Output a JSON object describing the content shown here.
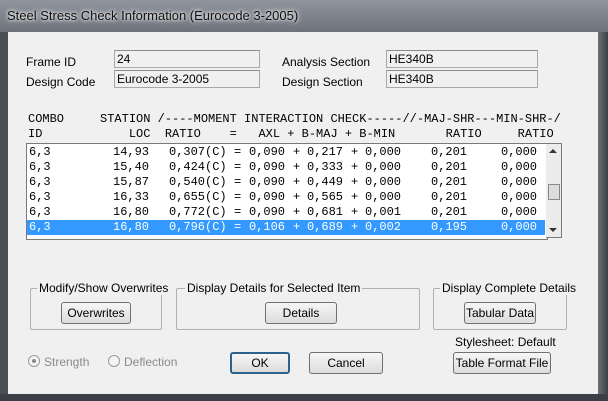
{
  "window": {
    "title": "Steel Stress Check Information  (Eurocode 3-2005)"
  },
  "info": {
    "frame_id_label": "Frame ID",
    "frame_id_value": "24",
    "design_code_label": "Design Code",
    "design_code_value": "Eurocode 3-2005",
    "analysis_section_label": "Analysis Section",
    "analysis_section_value": "HE340B",
    "design_section_label": "Design Section",
    "design_section_value": "HE340B"
  },
  "table": {
    "header_line1": "COMBO     STATION /----MOMENT INTERACTION CHECK-----//-MAJ-SHR---MIN-SHR-/",
    "header_line2": "ID            LOC  RATIO    =   AXL + B-MAJ + B-MIN       RATIO     RATIO",
    "rows": [
      {
        "combo": "6,3",
        "loc": "14,93",
        "ratio": "0,307(C)",
        "eq": "=",
        "axl": "0,090",
        "bmaj": "0,217",
        "bmin": "0,000",
        "maj_shr": "0,201",
        "min_shr": "0,000"
      },
      {
        "combo": "6,3",
        "loc": "15,40",
        "ratio": "0,424(C)",
        "eq": "=",
        "axl": "0,090",
        "bmaj": "0,333",
        "bmin": "0,000",
        "maj_shr": "0,201",
        "min_shr": "0,000"
      },
      {
        "combo": "6,3",
        "loc": "15,87",
        "ratio": "0,540(C)",
        "eq": "=",
        "axl": "0,090",
        "bmaj": "0,449",
        "bmin": "0,000",
        "maj_shr": "0,201",
        "min_shr": "0,000"
      },
      {
        "combo": "6,3",
        "loc": "16,33",
        "ratio": "0,655(C)",
        "eq": "=",
        "axl": "0,090",
        "bmaj": "0,565",
        "bmin": "0,000",
        "maj_shr": "0,201",
        "min_shr": "0,000"
      },
      {
        "combo": "6,3",
        "loc": "16,80",
        "ratio": "0,772(C)",
        "eq": "=",
        "axl": "0,090",
        "bmaj": "0,681",
        "bmin": "0,001",
        "maj_shr": "0,201",
        "min_shr": "0,000"
      },
      {
        "combo": "6,3",
        "loc": "16,80",
        "ratio": "0,796(C)",
        "eq": "=",
        "axl": "0,106",
        "bmaj": "0,689",
        "bmin": "0,002",
        "maj_shr": "0,195",
        "min_shr": "0,000",
        "selected": true
      }
    ]
  },
  "groups": {
    "overwrites_title": "Modify/Show Overwrites",
    "overwrites_button": "Overwrites",
    "details_title": "Display Details for Selected Item",
    "details_button": "Details",
    "complete_title": "Display Complete Details",
    "tabular_button": "Tabular Data"
  },
  "stylesheet_text": "Stylesheet: Default",
  "radios": {
    "strength": "Strength",
    "deflection": "Deflection"
  },
  "buttons": {
    "ok": "OK",
    "cancel": "Cancel",
    "table_format": "Table Format File"
  },
  "colors": {
    "selection": "#3399ff",
    "background": "#f0f0f0"
  }
}
